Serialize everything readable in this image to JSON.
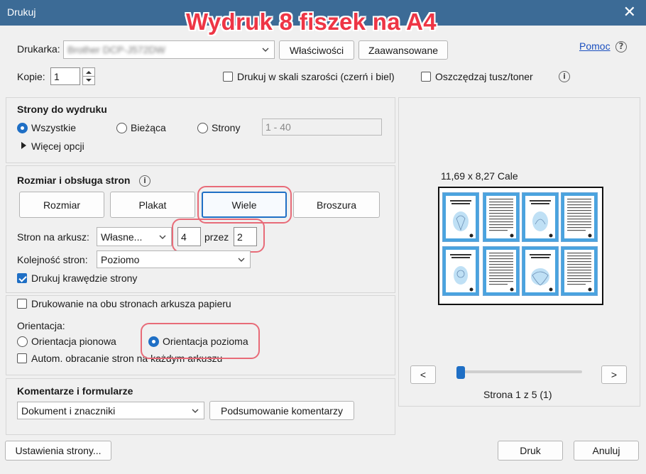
{
  "window": {
    "title": "Drukuj",
    "close_glyph": "✕"
  },
  "overlay_title": "Wydruk 8 fiszek na A4",
  "printer": {
    "label": "Drukarka:",
    "selected": "Brother DCP-J572DW",
    "properties_button": "Właściwości",
    "advanced_button": "Zaawansowane",
    "help_link": "Pomoc"
  },
  "copies": {
    "label": "Kopie:",
    "value": "1"
  },
  "options": {
    "grayscale": {
      "label": "Drukuj w skali szarości (czerń i biel)",
      "checked": false
    },
    "save_ink": {
      "label": "Oszczędzaj tusz/toner",
      "checked": false
    }
  },
  "pages_to_print": {
    "title": "Strony do wydruku",
    "all": "Wszystkie",
    "current": "Bieżąca",
    "pages": "Strony",
    "pages_range": "1 - 40",
    "more_options": "Więcej opcji",
    "selected": "all"
  },
  "sizing": {
    "title": "Rozmiar i obsługa stron",
    "tabs": [
      "Rozmiar",
      "Plakat",
      "Wiele",
      "Broszura"
    ],
    "active_tab": "Wiele",
    "pages_per_sheet_label": "Stron na arkusz:",
    "pages_per_sheet_value": "Własne...",
    "cols": "4",
    "by_label": "przez",
    "rows": "2",
    "order_label": "Kolejność stron:",
    "order_value": "Poziomo",
    "print_borders_label": "Drukuj krawędzie strony",
    "print_borders_checked": true
  },
  "duplex": {
    "label": "Drukowanie na obu stronach arkusza papieru",
    "checked": false
  },
  "orientation": {
    "title": "Orientacja:",
    "portrait": "Orientacja pionowa",
    "landscape": "Orientacja pozioma",
    "selected": "landscape",
    "auto_rotate": "Autom. obracanie stron na każdym arkuszu",
    "auto_rotate_checked": false
  },
  "comments": {
    "title": "Komentarze i formularze",
    "selected": "Dokument i znaczniki",
    "summary_button": "Podsumowanie komentarzy"
  },
  "preview": {
    "paper_size": "11,69 x 8,27 Cale",
    "prev_button": "<",
    "next_button": ">",
    "page_status": "Strona 1 z 5 (1)",
    "slider_fraction": 0.0
  },
  "footer": {
    "page_setup_button": "Ustawienia strony...",
    "print_button": "Druk",
    "cancel_button": "Anuluj"
  },
  "colors": {
    "accent": "#1f6fc5",
    "titlebar": "#3c6b96",
    "highlight": "#e86b78",
    "overlay_text": "#ee3545"
  }
}
